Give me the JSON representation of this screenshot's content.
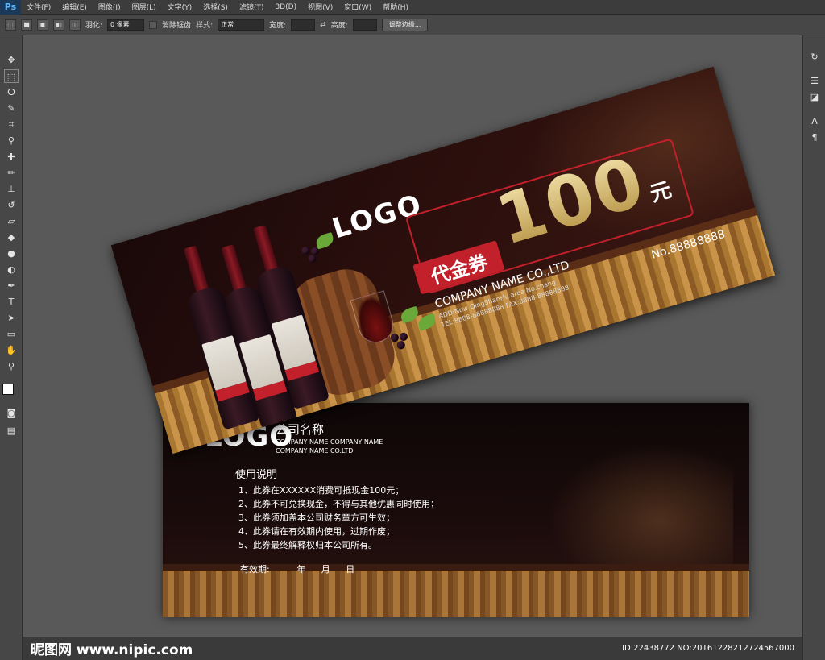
{
  "menubar": {
    "app_icon": "Ps",
    "items": [
      "文件(F)",
      "编辑(E)",
      "图像(I)",
      "图层(L)",
      "文字(Y)",
      "选择(S)",
      "滤镜(T)",
      "3D(D)",
      "视图(V)",
      "窗口(W)",
      "帮助(H)"
    ]
  },
  "options": {
    "feather_label": "羽化:",
    "feather_value": "0 像素",
    "antialias_label": "消除锯齿",
    "style_label": "样式:",
    "style_value": "正常",
    "width_label": "宽度:",
    "height_label": "高度:",
    "refine_edge_label": "调整边缘..."
  },
  "front": {
    "logo": "LOGO",
    "badge": "代金券",
    "amount": "100",
    "unit": "元",
    "company": "COMPANY NAME CO.,LTD",
    "address": "ADD:Now QingShanHu aroa No.chang",
    "tel": "TEL:8888-88888888   FAX:8888-88888888",
    "number": "No.88888888"
  },
  "back": {
    "logo": "LOGO",
    "company_cn": "公司名称",
    "company_line1": "COMPANY NAME COMPANY NAME",
    "company_line2": "COMPANY NAME CO.LTD",
    "instructions_title": "使用说明",
    "items": [
      "1、此券在XXXXXX消费可抵现金100元；",
      "2、此券不可兑换现金，不得与其他优惠同时使用；",
      "3、此券须加盖本公司财务章方可生效；",
      "4、此券请在有效期内使用，过期作废；",
      "5、此券最终解释权归本公司所有。"
    ],
    "valid_label": "有效期:",
    "year": "年",
    "month": "月",
    "day": "日"
  },
  "footer": {
    "brand": "昵图网 www.nipic.com",
    "watermark": "ID:22438772 NO:20161228212724567000"
  },
  "colors": {
    "accent_red": "#c2202a",
    "gold": "#d9c07a",
    "app_bg": "#535353"
  }
}
